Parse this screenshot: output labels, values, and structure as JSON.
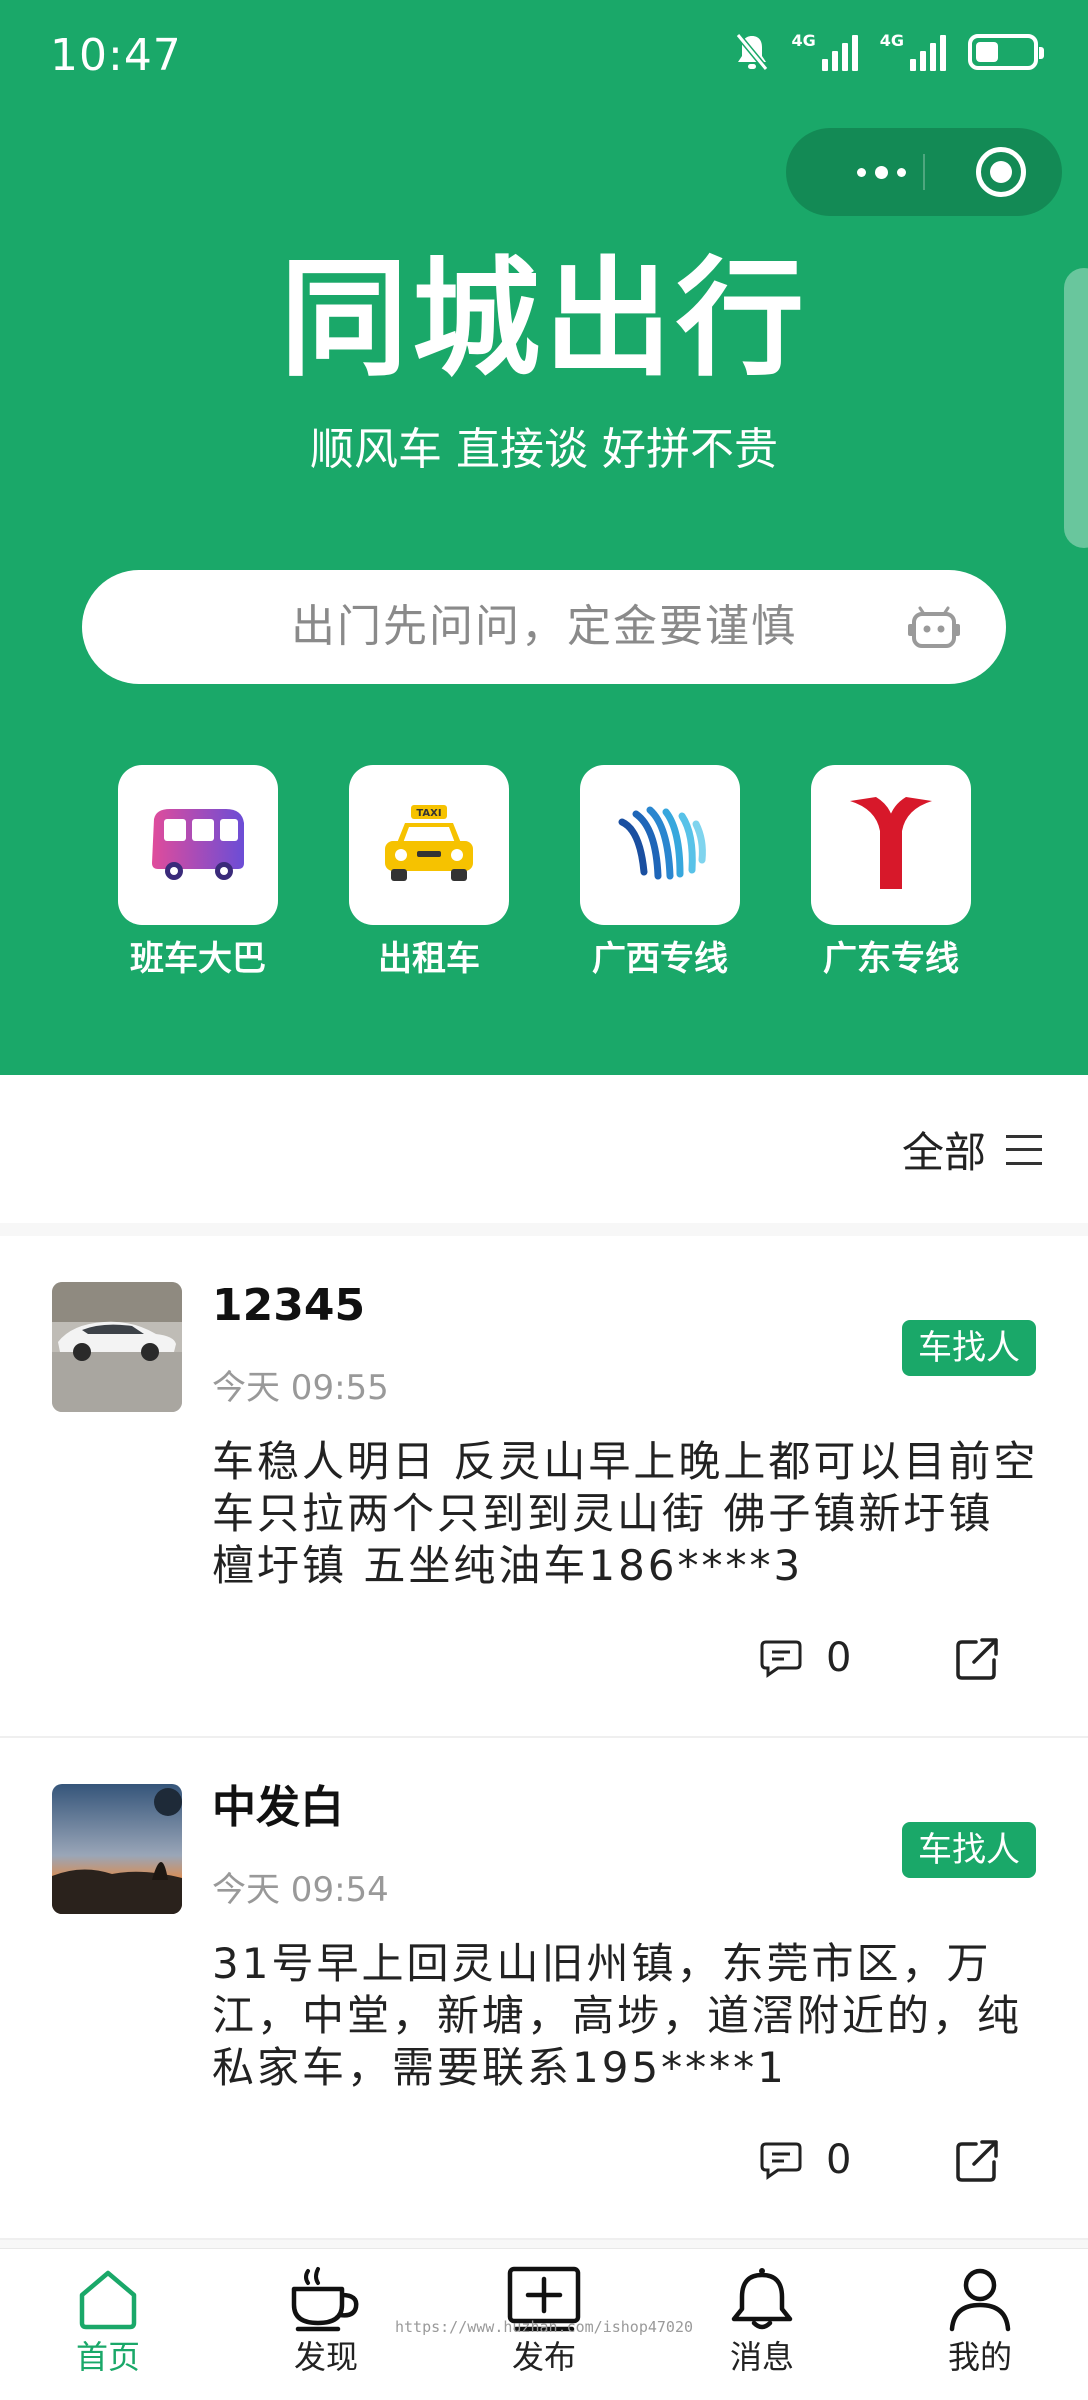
{
  "status_bar": {
    "time": "10:47",
    "net1": "4G",
    "net2": "4G"
  },
  "header": {
    "title": "同城出行",
    "subtitle": "顺风车 直接谈 好拼不贵",
    "search_placeholder": "出门先问问，定金要谨慎"
  },
  "categories": [
    {
      "label": "班车大巴",
      "icon": "bus-icon"
    },
    {
      "label": "出租车",
      "icon": "taxi-icon"
    },
    {
      "label": "广西专线",
      "icon": "guangxi-line-icon"
    },
    {
      "label": "广东专线",
      "icon": "guangdong-line-icon"
    }
  ],
  "taxi_sign": "TAXI",
  "filter": {
    "label": "全部"
  },
  "posts": [
    {
      "user": "12345",
      "time": "今天 09:55",
      "badge": "车找人",
      "body": "车稳人明日 反灵山早上晚上都可以目前空车只拉两个只到到灵山街 佛子镇新圩镇 檀圩镇 五坐纯油车186****3",
      "comments": "0"
    },
    {
      "user": "中发白",
      "time": "今天 09:54",
      "badge": "车找人",
      "body": "31号早上回灵山旧州镇，东莞市区，万江，中堂，新塘，高埗，道滘附近的，纯私家车，需要联系195****1",
      "comments": "0"
    }
  ],
  "tabbar": [
    {
      "label": "首页",
      "active": true
    },
    {
      "label": "发现"
    },
    {
      "label": "发布"
    },
    {
      "label": "消息"
    },
    {
      "label": "我的"
    }
  ],
  "watermark": "https://www.huzhan.com/ishop47020",
  "colors": {
    "brand": "#1aa869",
    "capsule": "#138a55",
    "text": "#222222",
    "muted": "#999999"
  }
}
